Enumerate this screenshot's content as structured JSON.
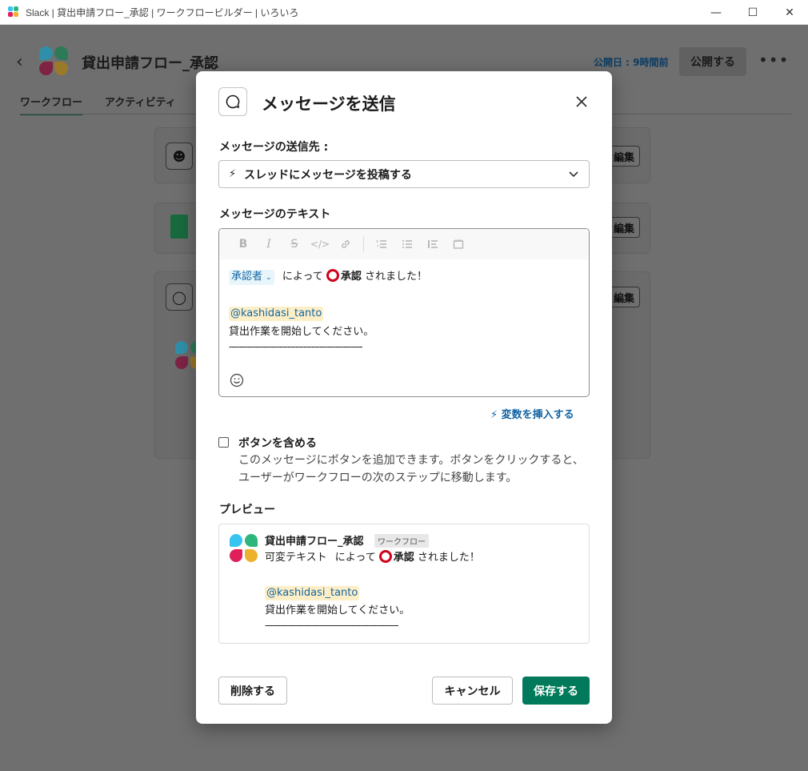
{
  "window": {
    "title": "Slack | 貸出申請フロー_承認 | ワークフロービルダー | いろいろ",
    "minimize": "—",
    "maximize": "☐",
    "close": "✕"
  },
  "app": {
    "back": "‹",
    "workflow_name": "貸出申請フロー_承認",
    "published": "公開日 : 9時間前",
    "publish_button": "公開する",
    "more": "•••",
    "tabs": [
      {
        "label": "ワークフロー"
      },
      {
        "label": "アクティビティ"
      }
    ],
    "cards": [
      {
        "edit": "編集"
      },
      {
        "edit": "編集"
      },
      {
        "edit": "編集"
      }
    ]
  },
  "modal": {
    "title": "メッセージを送信",
    "destination_label": "メッセージの送信先 :",
    "destination_value": "スレッドにメッセージを投稿する",
    "text_label": "メッセージのテキスト",
    "editor": {
      "var_chip": "承認者",
      "line1_a": "によって",
      "line1_bold": "承認",
      "line1_b": "されました！",
      "mention": "@kashidasi_tanto",
      "line3": "貸出作業を開始してください。",
      "line4": "--------------------------------------------------"
    },
    "insert_variable": "変数を挿入する",
    "include_buttons_label": "ボタンを含める",
    "include_buttons_help": "このメッセージにボタンを追加できます。ボタンをクリックすると、ユーザーがワークフローの次のステップに移動します。",
    "preview_label": "プレビュー",
    "preview": {
      "name": "貸出申請フロー_承認",
      "badge": "ワークフロー",
      "line1_var": "可変テキスト",
      "line1_a": "によって",
      "line1_bold": "承認",
      "line1_b": "されました！",
      "mention": "@kashidasi_tanto",
      "line3": "貸出作業を開始してください。",
      "line4": "--------------------------------------------------"
    },
    "delete_button": "削除する",
    "cancel_button": "キャンセル",
    "save_button": "保存する"
  },
  "colors": {
    "primary": "#007a5a",
    "link": "#1264a3",
    "mention_bg": "#fcefc7",
    "ring": "#d0021b"
  }
}
